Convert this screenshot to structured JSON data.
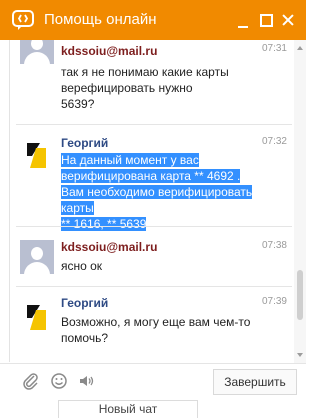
{
  "window": {
    "title": "Помощь онлайн",
    "accent_color": "#f18a00",
    "logo_icon": "chat-bubble-icon",
    "controls": [
      "minimize-icon",
      "maximize-icon",
      "close-icon"
    ]
  },
  "messages": [
    {
      "sender": "kdssoiu@mail.ru",
      "time": "07:31",
      "text": "так я не понимаю какие карты\nверефицировать нужно\n5639?",
      "avatar": "user-avatar-icon"
    },
    {
      "sender": "Георгий",
      "time": "07:32",
      "text": "На данный момент у вас\nверифицирована карта ** 4692 .\nВам необходимо верифицировать карты\n** 1616, ** 5639",
      "avatar": "agent-logo-icon",
      "highlighted": true
    },
    {
      "sender": "kdssoiu@mail.ru",
      "time": "07:38",
      "text": "ясно ок",
      "avatar": "user-avatar-icon"
    },
    {
      "sender": "Георгий",
      "time": "07:39",
      "text": "Возможно, я могу еще вам чем-то\nпомочь?",
      "avatar": "agent-logo-icon"
    }
  ],
  "toolbar": {
    "icons": [
      "paperclip-icon",
      "smile-icon",
      "speaker-icon"
    ],
    "finish_label": "Завершить"
  },
  "bottom_tab": {
    "label": "Новый чат"
  },
  "colors": {
    "user_name": "#7d1e1e",
    "agent_name": "#2e4a84",
    "selection": "#3390ff",
    "agent_logo": "#f5c400"
  }
}
